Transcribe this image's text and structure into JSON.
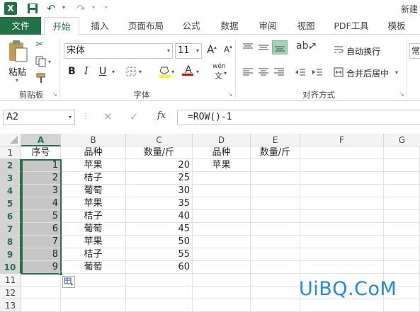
{
  "titlebar": {
    "app_icon": "excel-icon",
    "title": "新建"
  },
  "tabs": [
    {
      "label": "文件",
      "active": false,
      "file": true
    },
    {
      "label": "开始",
      "active": true
    },
    {
      "label": "插入"
    },
    {
      "label": "页面布局"
    },
    {
      "label": "公式"
    },
    {
      "label": "数据"
    },
    {
      "label": "审阅"
    },
    {
      "label": "视图"
    },
    {
      "label": "PDF工具"
    },
    {
      "label": "模板"
    }
  ],
  "ribbon": {
    "clipboard": {
      "paste_label": "粘贴",
      "group_label": "剪贴板"
    },
    "font": {
      "font_name": "宋体",
      "font_size": "11",
      "group_label": "字体",
      "phonetic_label": "wén"
    },
    "alignment": {
      "wrap_label": "自动换行",
      "merge_label": "合并后居中",
      "group_label": "对齐方式"
    },
    "number": {
      "partial_label": "常"
    }
  },
  "formula_bar": {
    "name_box": "A2",
    "fx": "fx",
    "formula": "=ROW()-1"
  },
  "columns": [
    "A",
    "B",
    "C",
    "D",
    "E",
    "F",
    "G"
  ],
  "rows": [
    "1",
    "2",
    "3",
    "4",
    "5",
    "6",
    "7",
    "8",
    "9",
    "10",
    "11",
    "12",
    "13"
  ],
  "sheet": {
    "A1": "序号",
    "B1": "品种",
    "C1": "数量/斤",
    "D1": "品种",
    "E1": "数量/斤",
    "A": [
      "1",
      "2",
      "3",
      "4",
      "5",
      "6",
      "7",
      "8",
      "9"
    ],
    "B": [
      "苹果",
      "桔子",
      "葡萄",
      "苹果",
      "桔子",
      "葡萄",
      "苹果",
      "桔子",
      "葡萄"
    ],
    "C": [
      "20",
      "25",
      "30",
      "35",
      "40",
      "45",
      "50",
      "55",
      "60"
    ],
    "D2": "苹果"
  },
  "watermark": "UiBQ.CoM",
  "colors": {
    "excel_green": "#217346",
    "selection": "#c6c6c6",
    "selection_border": "#217346"
  }
}
